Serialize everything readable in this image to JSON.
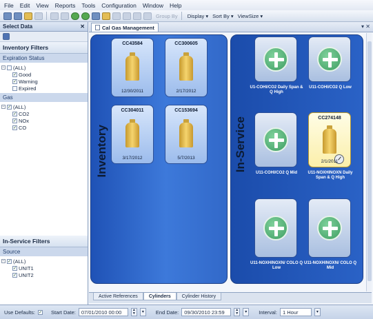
{
  "menu": [
    "File",
    "Edit",
    "View",
    "Reports",
    "Tools",
    "Configuration",
    "Window",
    "Help"
  ],
  "toolbar": {
    "group_by": "Group By",
    "display": "Display ▾",
    "sort_by": "Sort By ▾",
    "view_size": "ViewSize ▾"
  },
  "left": {
    "title": "Select Data",
    "close": "✕",
    "inventory_filters": "Inventory Filters",
    "expiration_status": "Expiration Status",
    "exp_items": [
      {
        "label": "(ALL)",
        "checked": false
      },
      {
        "label": "Good",
        "checked": true
      },
      {
        "label": "Warning",
        "checked": true
      },
      {
        "label": "Expired",
        "checked": false
      }
    ],
    "gas": "Gas",
    "gas_items": [
      {
        "label": "(ALL)",
        "checked": true
      },
      {
        "label": "CO2",
        "checked": true
      },
      {
        "label": "NOx",
        "checked": true
      },
      {
        "label": "CO",
        "checked": true
      }
    ],
    "inservice_filters": "In-Service Filters",
    "source": "Source",
    "source_items": [
      {
        "label": "(ALL)",
        "checked": true
      },
      {
        "label": "UNIT1",
        "checked": true
      },
      {
        "label": "UNIT2",
        "checked": true
      }
    ]
  },
  "main": {
    "tab": "Cal Gas Management",
    "tab_controls": "▾ ✕",
    "inventory_label": "Inventory",
    "inservice_label": "In-Service",
    "inventory_cards": [
      {
        "id": "CC43584",
        "date": "12/30/2011"
      },
      {
        "id": "CC300605",
        "date": "2/17/2012"
      },
      {
        "id": "CC304011",
        "date": "3/17/2012"
      },
      {
        "id": "CC153694",
        "date": "5/7/2013"
      }
    ],
    "inservice_cards": [
      {
        "kind": "add",
        "text": "U1-COHI/CO2 Daily Span & Q High"
      },
      {
        "kind": "add",
        "text": "U11-COHI/CO2 Q Low"
      },
      {
        "kind": "add",
        "text": "U11-COHI/CO2 Q Mid"
      },
      {
        "kind": "cylinder",
        "id": "CC274148",
        "date": "2/1/2011",
        "text": "U11-NOXHINOXN Daily Span & Q High"
      },
      {
        "kind": "add",
        "text": "U11-NOXHINOXN/ COLO Q Low"
      },
      {
        "kind": "add",
        "text": "U11-NOXHINOXN/ COLO Q Mid"
      }
    ],
    "bottom_tabs": [
      {
        "label": "Active References",
        "active": false
      },
      {
        "label": "Cylinders",
        "active": true
      },
      {
        "label": "Cylinder History",
        "active": false
      }
    ]
  },
  "status": {
    "use_defaults": "Use Defaults:",
    "use_defaults_checked": true,
    "start_label": "Start Date:",
    "start_value": "07/01/2010 00:00",
    "end_label": "End Date:",
    "end_value": "09/30/2010 23:59",
    "interval_label": "Interval:",
    "interval_value": "1 Hour"
  }
}
